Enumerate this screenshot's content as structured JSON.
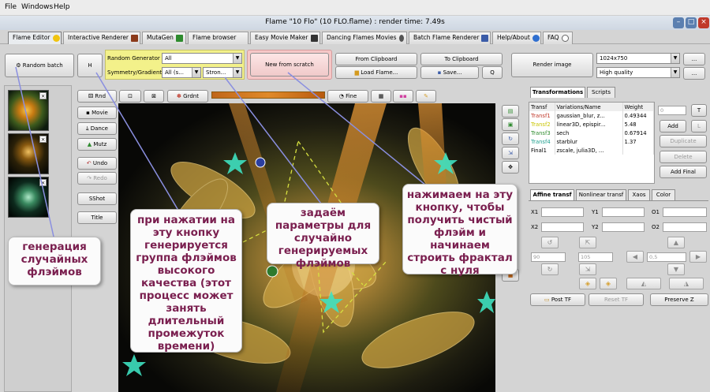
{
  "menu": [
    "File",
    "Windows",
    "Help"
  ],
  "window": {
    "title": "Flame \"10 Flo\" (10 FLO.flame) : render time: 7.49s"
  },
  "tabs": [
    {
      "label": "Flame Editor",
      "icon": "sun-icon",
      "active": true
    },
    {
      "label": "Interactive Renderer",
      "icon": "play-icon"
    },
    {
      "label": "MutaGen",
      "icon": "tree-icon"
    },
    {
      "label": "Flame browser",
      "icon": "folder-icon"
    },
    {
      "label": "Easy Movie Maker",
      "icon": "film-icon"
    },
    {
      "label": "Dancing Flames Movies",
      "icon": "dancer-icon"
    },
    {
      "label": "Batch Flame Renderer",
      "icon": "batch-icon"
    },
    {
      "label": "Help/About",
      "icon": "info-icon"
    },
    {
      "label": "FAQ",
      "icon": "lightbulb-icon"
    }
  ],
  "toolbar": {
    "random_batch": "Random batch",
    "h": "H",
    "random_generator_label": "Random Generator",
    "random_generator_value": "All",
    "symmetry_label": "Symmetry/Gradient",
    "symmetry_value": "All (s...",
    "strength_value": "Stron...",
    "new_from_scratch": "New from scratch",
    "from_clipboard": "From Clipboard",
    "to_clipboard": "To Clipboard",
    "load_flame": "Load Flame...",
    "save": "Save...",
    "q": "Q",
    "render_image": "Render image",
    "resolution": "1024x750",
    "quality": "High quality",
    "more": "..."
  },
  "left_buttons": [
    "Rnd",
    "Movie",
    "Dance",
    "Mutz",
    "Undo",
    "Redo",
    "SShot",
    "Title"
  ],
  "canvas_toolbar": {
    "gradient": "Grdnt",
    "fine": "Fine"
  },
  "right_panel": {
    "tabs": [
      "Transformations",
      "Scripts"
    ],
    "headers": [
      "Transf",
      "Variations/Name",
      "Weight"
    ],
    "rows": [
      {
        "name": "Transf1",
        "variations": "gaussian_blur, z...",
        "weight": "0.49344",
        "color": "#c0392b"
      },
      {
        "name": "Transf2",
        "variations": "linear3D, epispir...",
        "weight": "5.48",
        "color": "#c9c500"
      },
      {
        "name": "Transf3",
        "variations": "sech",
        "weight": "0.67914",
        "color": "#2e8b2e"
      },
      {
        "name": "Transf4",
        "variations": "starblur",
        "weight": "1.37",
        "color": "#1e9e8e"
      },
      {
        "name": "Final1",
        "variations": "zscale, julia3D, ...",
        "weight": "",
        "color": "#000000"
      }
    ],
    "side": {
      "spin": "0",
      "t": "T",
      "add": "Add",
      "l": "L",
      "duplicate": "Duplicate",
      "delete": "Delete",
      "add_final": "Add Final"
    },
    "subtabs": [
      "Affine transf",
      "Nonlinear transf",
      "Xaos",
      "Color"
    ],
    "coords": [
      "X1",
      "Y1",
      "O1",
      "X2",
      "Y2",
      "O2"
    ],
    "values": {
      "rot": "90",
      "scale": "105",
      "step": "0,5"
    },
    "bottom": [
      "Post TF",
      "Reset TF",
      "Preserve Z"
    ]
  },
  "callouts": {
    "random": "генерация случайных флэймов",
    "h_button": "при нажатии на эту кнопку генерируется группа флэймов высокого качества (этот процесс может занять длительный промежуток времени)",
    "params": "задаём параметры для случайно генерируемых флэймов",
    "scratch": "нажимаем на эту кнопку, чтобы получить чистый флэйм и начинаем строить фрактал с нуля"
  },
  "colors": {
    "callout_text": "#7a1f4f",
    "highlight_yellow": "#f3f18a",
    "highlight_pink": "#f6c7c7"
  }
}
